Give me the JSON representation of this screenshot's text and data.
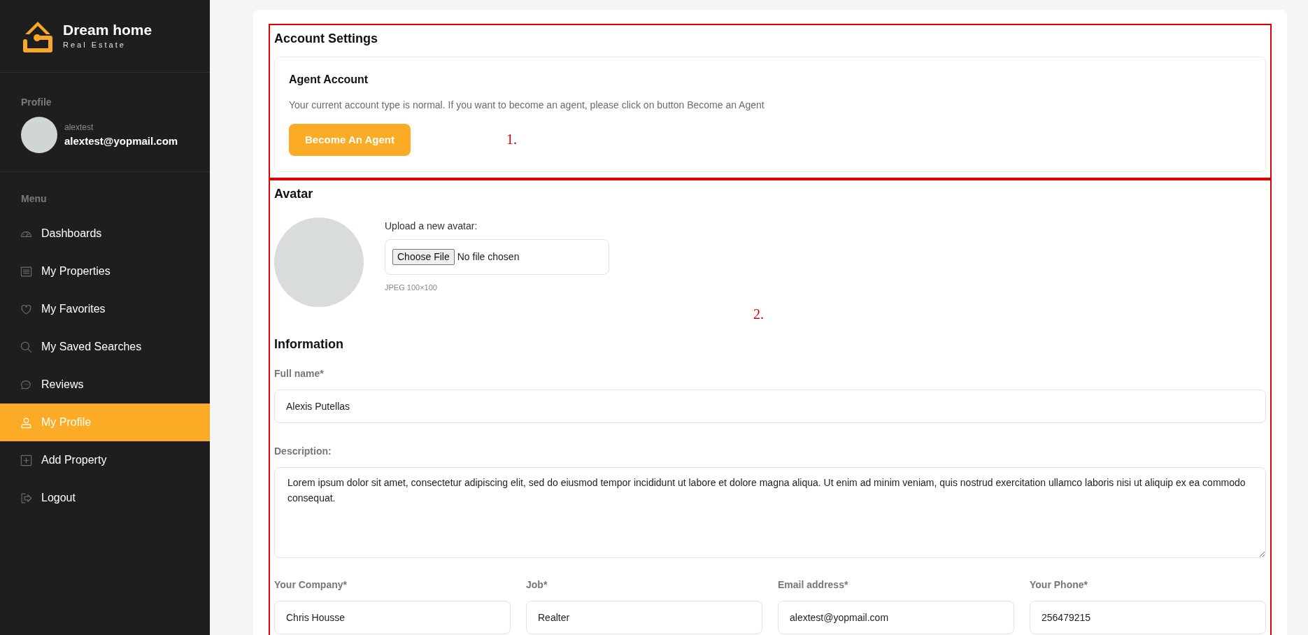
{
  "sidebar": {
    "brand": {
      "title": "Dream home",
      "subtitle": "Real Estate"
    },
    "profile": {
      "heading": "Profile",
      "username": "alextest",
      "email": "alextest@yopmail.com"
    },
    "menu": {
      "heading": "Menu",
      "items": [
        {
          "label": "Dashboards",
          "selected": false
        },
        {
          "label": "My Properties",
          "selected": false
        },
        {
          "label": "My Favorites",
          "selected": false
        },
        {
          "label": "My Saved Searches",
          "selected": false
        },
        {
          "label": "Reviews",
          "selected": false
        },
        {
          "label": "My Profile",
          "selected": true
        },
        {
          "label": "Add Property",
          "selected": false
        },
        {
          "label": "Logout",
          "selected": false
        }
      ]
    }
  },
  "account_settings": {
    "title": "Account Settings",
    "agent_card": {
      "title": "Agent Account",
      "text": "Your current account type is normal. If you want to become an agent, please click on button Become an Agent",
      "button": "Become An Agent"
    }
  },
  "avatar": {
    "title": "Avatar",
    "upload_label": "Upload a new avatar:",
    "file_button": "Choose File",
    "file_status": "No file chosen",
    "hint": "JPEG 100×100"
  },
  "information": {
    "title": "Information",
    "full_name": {
      "label": "Full name*",
      "value": "Alexis Putellas"
    },
    "description": {
      "label": "Description:",
      "value": "Lorem ipsum dolor sit amet, consectetur adipiscing elit, sed do eiusmod tempor incididunt ut labore et dolore magna aliqua. Ut enim ad minim veniam, quis nostrud exercitation ullamco laboris nisi ut aliquip ex ea commodo consequat."
    },
    "fields": [
      {
        "label": "Your Company*",
        "value": "Chris Housse"
      },
      {
        "label": "Job*",
        "value": "Realter"
      },
      {
        "label": "Email address*",
        "value": "alextest@yopmail.com"
      },
      {
        "label": "Your Phone*",
        "value": "256479215"
      }
    ]
  },
  "annotations": [
    {
      "label": "1."
    },
    {
      "label": "2."
    }
  ]
}
